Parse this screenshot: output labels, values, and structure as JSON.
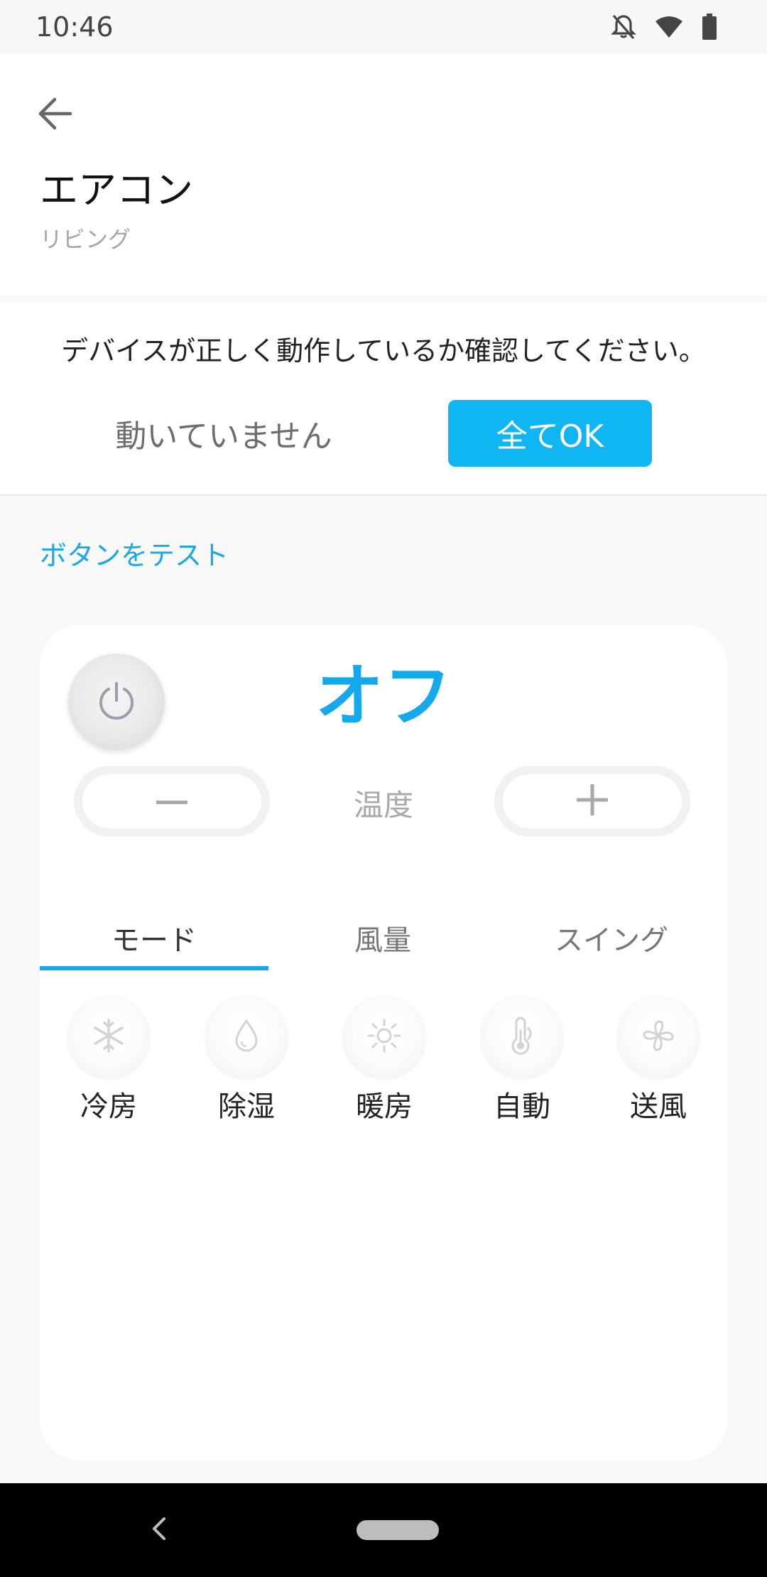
{
  "status_bar": {
    "time": "10:46",
    "icons": [
      "notifications-off-icon",
      "wifi-icon",
      "battery-icon"
    ]
  },
  "header": {
    "back_icon": "arrow-left-icon",
    "title": "エアコン",
    "subtitle": "リビング"
  },
  "confirm": {
    "message": "デバイスが正しく動作しているか確認してください。",
    "not_working_label": "動いていません",
    "all_ok_label": "全てOK"
  },
  "test_label": "ボタンをテスト",
  "remote": {
    "power_icon": "power-icon",
    "power_state": "オフ",
    "temp_label": "温度",
    "temp_minus_icon": "minus-icon",
    "temp_plus_icon": "plus-icon",
    "tabs": [
      {
        "label": "モード",
        "selected": true
      },
      {
        "label": "風量",
        "selected": false
      },
      {
        "label": "スイング",
        "selected": false
      }
    ],
    "modes": [
      {
        "label": "冷房",
        "icon": "snowflake-icon"
      },
      {
        "label": "除湿",
        "icon": "droplet-icon"
      },
      {
        "label": "暖房",
        "icon": "sun-icon"
      },
      {
        "label": "自動",
        "icon": "thermometer-icon"
      },
      {
        "label": "送風",
        "icon": "fan-icon"
      }
    ]
  },
  "nav_bar": {
    "back_icon": "nav-back-icon",
    "home_icon": "home-pill-icon"
  },
  "colors": {
    "accent": "#13a9ec",
    "ok_button": "#10b6f2",
    "background": "#f8f8f8",
    "card": "#ffffff"
  }
}
